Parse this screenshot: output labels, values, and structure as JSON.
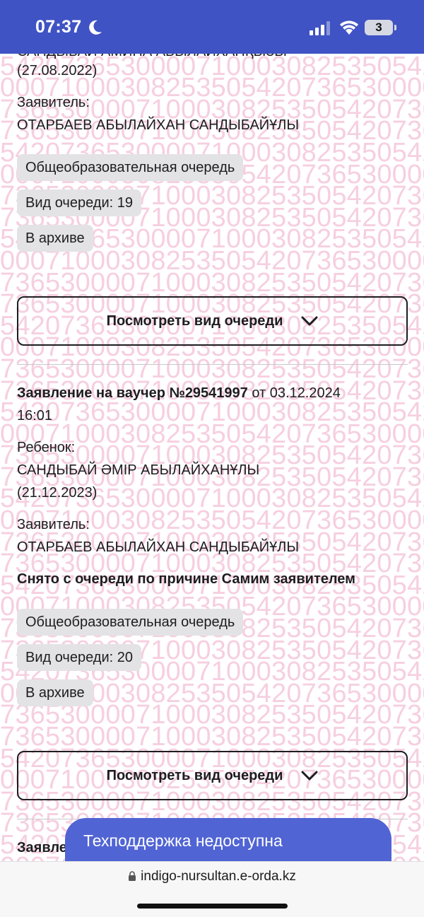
{
  "status_bar": {
    "time": "07:37",
    "battery": "3"
  },
  "watermark": {
    "lines": [
      "736530000710003082535054207365307",
      "542073653000071000308253505420736",
      "000710003082535054207365300007100",
      "736530000710003082535054207365300"
    ]
  },
  "app1": {
    "child_name_cut": "САНДЫБАЙ АМИНА АБЫЛАЙХАНҚЫЗЫ",
    "child_dob": "(27.08.2022)",
    "applicant_label": "Заявитель:",
    "applicant_name": "ОТАРБАЕВ АБЫЛАЙХАН САНДЫБАЙҰЛЫ",
    "chips": [
      "Общеобразовательная очередь",
      "Вид очереди: 19",
      "В архиве"
    ],
    "button": "Посмотреть вид очереди"
  },
  "app2": {
    "title": "Заявление на ваучер №29541997",
    "date_prefix": " от 03.12.2024",
    "time": "16:01",
    "child_label": "Ребенок:",
    "child_name": "САНДЫБАЙ ӘМІР АБЫЛАЙХАНҰЛЫ",
    "child_dob": "(21.12.2023)",
    "applicant_label": "Заявитель:",
    "applicant_name": "ОТАРБАЕВ АБЫЛАЙХАН САНДЫБАЙҰЛЫ",
    "removed_reason": "Снято с очереди по причине Самим заявителем",
    "chips": [
      "Общеобразовательная очередь",
      "Вид очереди: 20",
      "В архиве"
    ],
    "button": "Посмотреть вид очереди"
  },
  "app3": {
    "title_cut": "Заявле"
  },
  "support": {
    "label": "Техподдержка недоступна"
  },
  "browser": {
    "url": "indigo-nursultan.e-orda.kz"
  }
}
